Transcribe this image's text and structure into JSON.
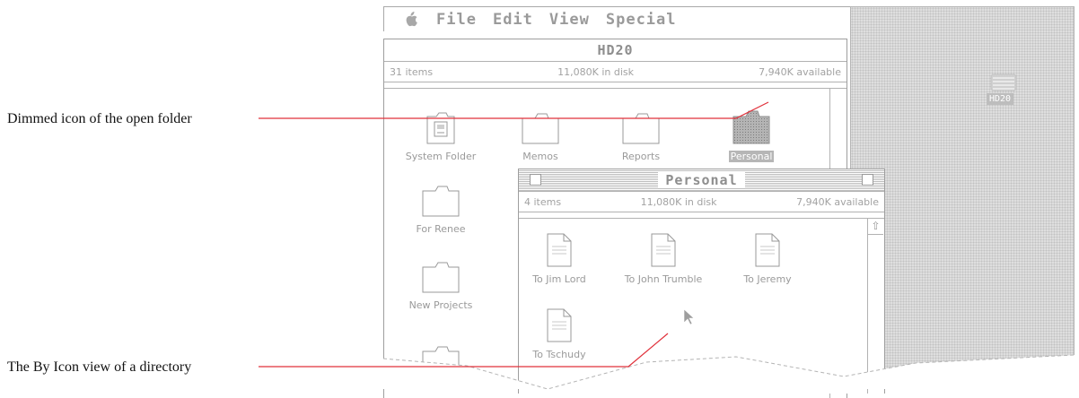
{
  "menubar": {
    "menus": [
      "File",
      "Edit",
      "View",
      "Special"
    ]
  },
  "callouts": [
    "Dimmed icon of the open folder",
    "The By Icon view of a directory"
  ],
  "desktop": {
    "disk_label": "HD20"
  },
  "hd20": {
    "title": "HD20",
    "items_count": "31 items",
    "in_disk": "11,080K in disk",
    "available": "7,940K available",
    "items": [
      "System Folder",
      "Memos",
      "Reports",
      "Personal",
      "For Renee",
      "New Projects"
    ]
  },
  "personal": {
    "title": "Personal",
    "items_count": "4 items",
    "in_disk": "11,080K in disk",
    "available": "7,940K available",
    "items": [
      "To Jim Lord",
      "To John Trumble",
      "To Jeremy",
      "To Tschudy"
    ]
  },
  "colors": {
    "callout_line": "#e0303a",
    "desktop": "#dedede"
  },
  "icons": [
    "apple-icon",
    "folder-icon",
    "system-folder-icon",
    "document-icon",
    "disk-icon",
    "pointer-icon",
    "scroll-up-arrow-icon",
    "close-box-icon",
    "zoom-box-icon"
  ]
}
